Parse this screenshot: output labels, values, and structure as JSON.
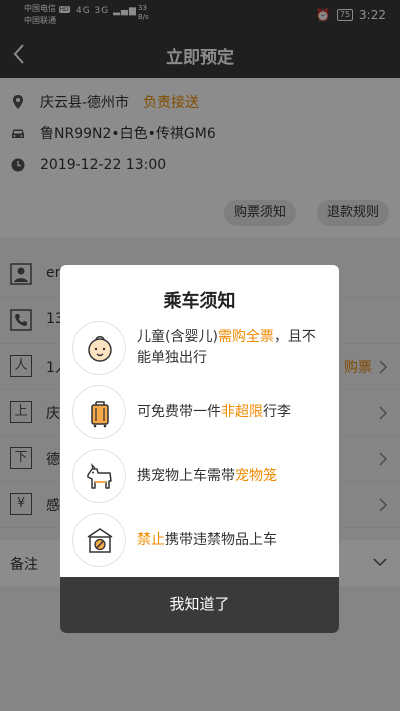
{
  "status_bar": {
    "carrier_1": "中国电信",
    "carrier_1_badge": "HD",
    "carrier_2": "中国联通",
    "network": "4G 3G",
    "speed_value": "33",
    "speed_unit": "B/s",
    "battery": "75",
    "time": "3:22"
  },
  "header": {
    "title": "立即预定"
  },
  "trip": {
    "route": "庆云县-德州市",
    "route_tag": "负责接送",
    "vehicle": "鲁NR99N2•白色•传祺GM6",
    "datetime": "2019-12-22 13:00",
    "notice_button": "购票须知",
    "refund_button": "退款规则"
  },
  "form": {
    "name_partial": "en",
    "phone_partial": "13",
    "passengers_partial": "1人",
    "passengers_icon_char": "人",
    "passengers_right": "购票",
    "board_icon_char": "上",
    "board_partial": "庆",
    "alight_icon_char": "下",
    "alight_partial": "德",
    "coupon_partial": "感谢",
    "coupon_icon_char": "¥",
    "remark_label": "备注"
  },
  "modal": {
    "title": "乘车须知",
    "items": [
      {
        "icon": "child-icon",
        "pre": "儿童(含婴儿)",
        "hl": "需购全票",
        "post": "，且不能单独出行"
      },
      {
        "icon": "luggage-icon",
        "pre": "可免费带一件",
        "hl": "非超限",
        "post": "行李"
      },
      {
        "icon": "pet-icon",
        "pre": "携宠物上车需带",
        "hl": "宠物笼",
        "post": ""
      },
      {
        "icon": "prohibited-box-icon",
        "pre": "",
        "hl": "禁止",
        "post": "携带违禁物品上车"
      }
    ],
    "confirm_label": "我知道了"
  },
  "colors": {
    "accent": "#f08a00",
    "dark": "#3a3a3a"
  }
}
